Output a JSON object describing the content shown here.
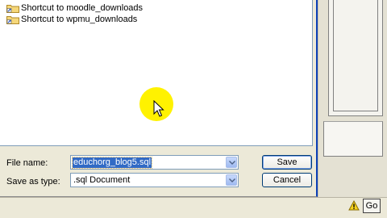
{
  "file_list": {
    "items": [
      {
        "label": "Shortcut to moodle_downloads",
        "icon": "folder-shortcut-icon"
      },
      {
        "label": "Shortcut to wpmu_downloads",
        "icon": "folder-shortcut-icon"
      }
    ]
  },
  "file_name": {
    "label": "File name:",
    "value": "educhorg_blog5.sql"
  },
  "save_as_type": {
    "label": "Save as type:",
    "value": ".sql Document"
  },
  "buttons": {
    "save": "Save",
    "cancel": "Cancel",
    "go": "Go"
  },
  "colors": {
    "dialog_bg": "#ece9d8",
    "selection": "#316ac5",
    "cursor_highlight": "#fff200",
    "window_border": "#0b3fb6"
  }
}
